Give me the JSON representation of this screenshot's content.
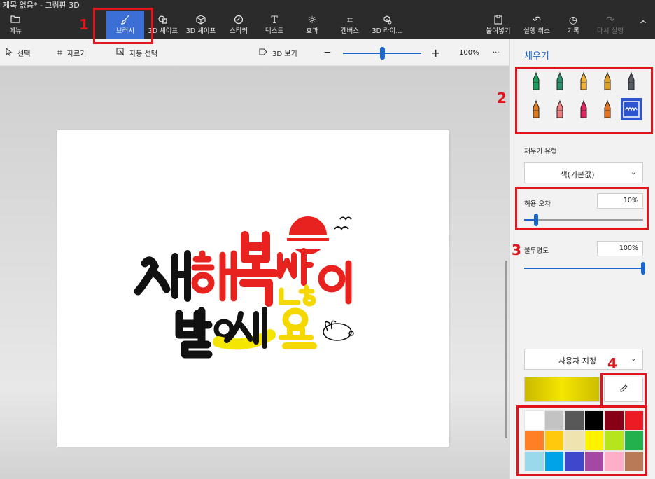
{
  "window": {
    "title": "제목 없음* - 그림판 3D"
  },
  "ribbon": {
    "menu": "메뉴",
    "brushes": "브러시",
    "shapes_2d": "2D 셰이프",
    "shapes_3d": "3D 셰이프",
    "stickers": "스티커",
    "text": "텍스트",
    "effects": "효과",
    "canvas": "캔버스",
    "library_3d": "3D 라이...",
    "paste": "붙여넣기",
    "undo": "실행 취소",
    "history": "기록",
    "redo": "다시 실행",
    "collapse": "^"
  },
  "toolbar": {
    "select": "선택",
    "crop": "자르기",
    "magic_select": "자동 선택",
    "view_3d": "3D 보기",
    "zoom_out": "−",
    "zoom_in": "+",
    "zoom": "100%",
    "zoom_level": 0.5,
    "more": "···"
  },
  "panel": {
    "title": "채우기",
    "fill_type_label": "채우기 유형",
    "fill_type_value": "색(기본값)",
    "tolerance_label": "허용 오차",
    "tolerance_value": "10%",
    "tolerance_level": 0.1,
    "opacity_label": "불투명도",
    "opacity_value": "100%",
    "opacity_level": 1.0,
    "color_mode": "사용자 지정",
    "current_color": "#f5e600",
    "brushes": [
      {
        "name": "marker-icon",
        "color": "#18a05a"
      },
      {
        "name": "calligraphy-pen-icon",
        "color": "#2f8f6a"
      },
      {
        "name": "oil-brush-icon",
        "color": "#f2b233"
      },
      {
        "name": "watercolor-icon",
        "color": "#e0a020"
      },
      {
        "name": "pixel-pen-icon",
        "color": "#555a66"
      },
      {
        "name": "pencil-icon",
        "color": "#e07a1f"
      },
      {
        "name": "eraser-icon",
        "color": "#f08080"
      },
      {
        "name": "crayon-icon",
        "color": "#e0245e"
      },
      {
        "name": "spray-can-icon",
        "color": "#e8731e"
      },
      {
        "name": "fill-icon",
        "color": "#2c55cf"
      }
    ],
    "palette": [
      "#ffffff",
      "#c3c3c3",
      "#585858",
      "#000000",
      "#880015",
      "#ed1c24",
      "#ff7f27",
      "#ffc90e",
      "#efe4b0",
      "#fff200",
      "#b5e61d",
      "#22b14c",
      "#99d9ea",
      "#00a2e8",
      "#3f48cc",
      "#a349a4",
      "#ffaec9",
      "#b97a57"
    ]
  },
  "annotations": [
    "1",
    "2",
    "3",
    "4"
  ]
}
